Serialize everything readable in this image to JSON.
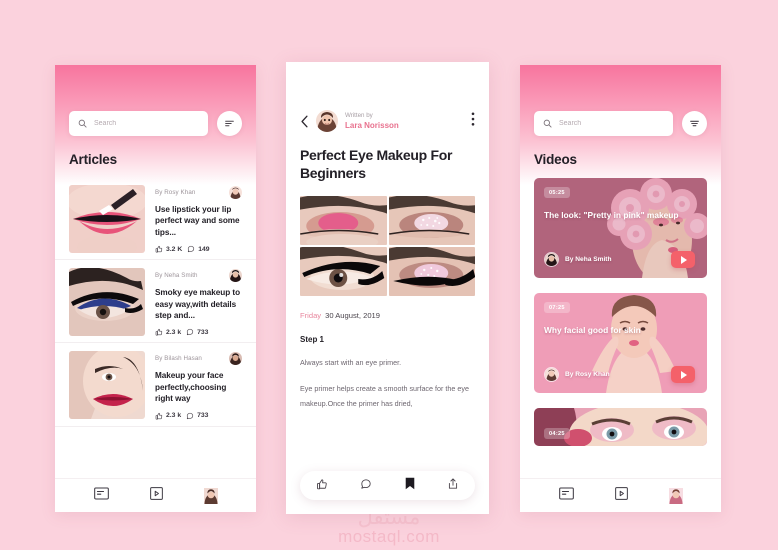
{
  "theme": {
    "page_bg": "#FBD2DD",
    "gradient_top": "#F7749E",
    "accent_pink": "#E8728F",
    "play_red": "#F4616A",
    "text_dark": "#232027",
    "text_muted": "#9d949a"
  },
  "watermark": {
    "arabic": "مستقل",
    "latin": "mostaql.com"
  },
  "screens": {
    "articles": {
      "search": {
        "placeholder": "Search",
        "value": "",
        "icon": "search-icon"
      },
      "filter_icon": "sort-filter-icon",
      "title": "Articles",
      "items": [
        {
          "byline": "By Rosy Khan",
          "title": "Use lipstick your lip perfect way and some tips...",
          "likes": "3.2 K",
          "comments": "149",
          "thumb": "lipstick-application-photo",
          "avatar": "rosy-khan-avatar"
        },
        {
          "byline": "By Neha Smith",
          "title": "Smoky eye makeup to easy way,with details step and...",
          "likes": "2.3 k",
          "comments": "733",
          "thumb": "blue-smoky-eye-photo",
          "avatar": "neha-smith-avatar"
        },
        {
          "byline": "By Bilash Hasan",
          "title": "Makeup your face perfectly,choosing right way",
          "likes": "2.3 k",
          "comments": "733",
          "thumb": "red-lips-face-photo",
          "avatar": "bilash-hasan-avatar"
        }
      ],
      "nav": [
        {
          "name": "articles",
          "icon": "article-list-icon",
          "active": true
        },
        {
          "name": "videos",
          "icon": "play-square-icon",
          "active": false
        },
        {
          "name": "profile",
          "icon": "profile-avatar",
          "active": false
        }
      ]
    },
    "article_detail": {
      "back_icon": "chevron-left-icon",
      "more_icon": "more-vertical-icon",
      "written_by_label": "Written by",
      "author": "Lara Norisson",
      "author_avatar": "lara-norisson-avatar",
      "headline": "Perfect Eye Makeup For Beginners",
      "gallery": [
        "pink-eyeshadow-closed-eye",
        "glitter-eyeshadow-closed-eye",
        "winged-liner-open-eye",
        "pink-glitter-liner-eye"
      ],
      "date_day": "Friday",
      "date_rest": "30 August, 2019",
      "step_title": "Step 1",
      "paragraphs": [
        "Always start with an eye primer.",
        "Eye primer helps create a smooth surface for the eye makeup.Once the primer has dried,"
      ],
      "actions": [
        {
          "name": "like",
          "icon": "thumbs-up-icon",
          "active": false
        },
        {
          "name": "comment",
          "icon": "comment-bubble-icon",
          "active": false
        },
        {
          "name": "bookmark",
          "icon": "bookmark-filled-icon",
          "active": true
        },
        {
          "name": "share",
          "icon": "share-upload-icon",
          "active": false
        }
      ]
    },
    "videos": {
      "search": {
        "placeholder": "Search",
        "value": "",
        "icon": "search-icon"
      },
      "filter_icon": "funnel-filter-icon",
      "title": "Videos",
      "items": [
        {
          "duration": "05:25",
          "title": "The look: \"Pretty in pink\" makeup",
          "author": "By Neha Smith",
          "avatar": "neha-smith-avatar",
          "thumb": "pink-peony-flower-crown-model",
          "play_icon": "play-button-icon"
        },
        {
          "duration": "07:25",
          "title": "Why facial good for skin",
          "author": "By Rosy Khan",
          "avatar": "rosy-khan-avatar",
          "thumb": "facial-skincare-model",
          "play_icon": "play-button-icon"
        },
        {
          "duration": "04:25",
          "title": "",
          "author": "",
          "avatar": "",
          "thumb": "pink-eye-makeup-model",
          "play_icon": "play-button-icon"
        }
      ],
      "nav": [
        {
          "name": "articles",
          "icon": "article-list-icon",
          "active": false
        },
        {
          "name": "videos",
          "icon": "play-square-icon",
          "active": true
        },
        {
          "name": "profile",
          "icon": "profile-avatar",
          "active": false
        }
      ]
    }
  }
}
